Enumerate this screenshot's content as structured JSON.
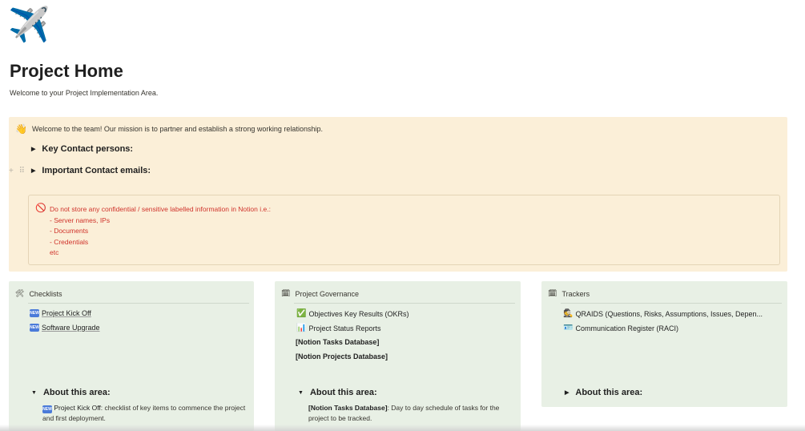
{
  "page": {
    "icon": "✈️",
    "icon_name": "airplane-icon",
    "title": "Project Home",
    "subtitle": "Welcome to your Project Implementation Area."
  },
  "callout": {
    "icon": "👋",
    "text": "Welcome to the team! Our mission is to partner and establish a strong working relationship.",
    "toggles": [
      "Key Contact persons:",
      "Important Contact emails:"
    ],
    "warning": {
      "icon": "🚫",
      "lines": [
        "Do not store any confidential / sensitive labelled information in Notion i.e.:",
        "- Server names, IPs",
        "- Documents",
        "- Credentials",
        "etc"
      ]
    }
  },
  "columns": {
    "checklists": {
      "icon": "🛠",
      "heading": "Checklists",
      "items": [
        "Project Kick Off",
        "Software Upgrade"
      ],
      "about_label": "About this area:",
      "about_link": "Project Kick Off",
      "about_text": ": checklist of key items to commence the project and first deployment."
    },
    "governance": {
      "icon": "🗓",
      "heading": "Project Governance",
      "items": [
        "Objectives Key Results (OKRs)",
        "Project Status Reports",
        "[Notion Tasks Database]",
        "[Notion Projects Database]"
      ],
      "about_label": "About this area:",
      "about_bold": "[Notion Tasks Database]",
      "about_text": ": Day to day schedule of tasks for the project to be tracked."
    },
    "trackers": {
      "icon": "🗓",
      "heading": "Trackers",
      "items": [
        "QRAIDS (Questions, Risks, Assumptions, Issues, Depen...",
        "Communication Register (RACI)"
      ],
      "about_label": "About this area:"
    }
  },
  "badge_text": "NEW",
  "colors": {
    "callout_bg": "#fbefd8",
    "column_bg": "#e8f0e5",
    "warning_text": "#d0342c"
  }
}
